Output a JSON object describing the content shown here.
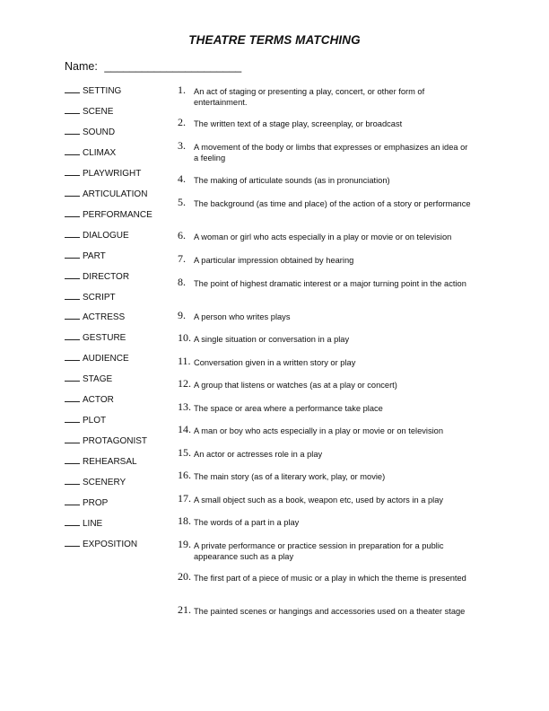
{
  "title": "THEATRE TERMS MATCHING",
  "name_label": "Name:",
  "name_blank": "______________________",
  "term_blank": "",
  "terms": [
    "SETTING",
    "SCENE",
    "SOUND",
    "CLIMAX",
    "PLAYWRIGHT",
    "ARTICULATION",
    "PERFORMANCE",
    "DIALOGUE",
    "PART",
    "DIRECTOR",
    "SCRIPT",
    "ACTRESS",
    "GESTURE",
    "AUDIENCE",
    "STAGE",
    "ACTOR",
    "PLOT",
    "PROTAGONIST",
    "REHEARSAL",
    "SCENERY",
    "PROP",
    "LINE",
    "EXPOSITION"
  ],
  "definitions": [
    {
      "num": "1.",
      "text": "An act of staging or presenting a play, concert, or other form of entertainment."
    },
    {
      "num": "2.",
      "text": "The written text of a stage play, screenplay, or broadcast"
    },
    {
      "num": "3.",
      "text": "A movement of the body or limbs that expresses or emphasizes an idea or a feeling"
    },
    {
      "num": "4.",
      "text": "The making of articulate sounds (as in pronunciation)"
    },
    {
      "num": "5.",
      "text": "The background (as time and place) of the action of a story or performance"
    },
    {
      "num": "6.",
      "text": "A woman or girl who acts especially in a play or movie or on television"
    },
    {
      "num": "7.",
      "text": "A particular impression obtained by hearing"
    },
    {
      "num": "8.",
      "text": "The point of highest dramatic interest or a major turning point in the action"
    },
    {
      "num": "9.",
      "text": "A person who writes plays"
    },
    {
      "num": "10.",
      "text": "A single situation or conversation in a play"
    },
    {
      "num": "11.",
      "text": "Conversation given in a written story or play"
    },
    {
      "num": "12.",
      "text": "A group that listens or watches (as at a play or concert)"
    },
    {
      "num": "13.",
      "text": "The space or area where a performance take place"
    },
    {
      "num": "14.",
      "text": "A man or boy who acts especially in a play or movie or on television"
    },
    {
      "num": "15.",
      "text": "An actor or actresses role in a play"
    },
    {
      "num": "16.",
      "text": "The main story (as of a literary work, play, or movie)"
    },
    {
      "num": "17.",
      "text": "A small object such as a book, weapon etc, used by actors in a play"
    },
    {
      "num": "18.",
      "text": "The words of a part in a play"
    },
    {
      "num": "19.",
      "text": "A private performance or practice session in preparation for a public appearance such as a play"
    },
    {
      "num": "20.",
      "text": "The first part of a piece of music or a play in which the theme is presented"
    },
    {
      "num": "21.",
      "text": "The painted scenes or hangings and accessories used on a theater stage"
    }
  ]
}
